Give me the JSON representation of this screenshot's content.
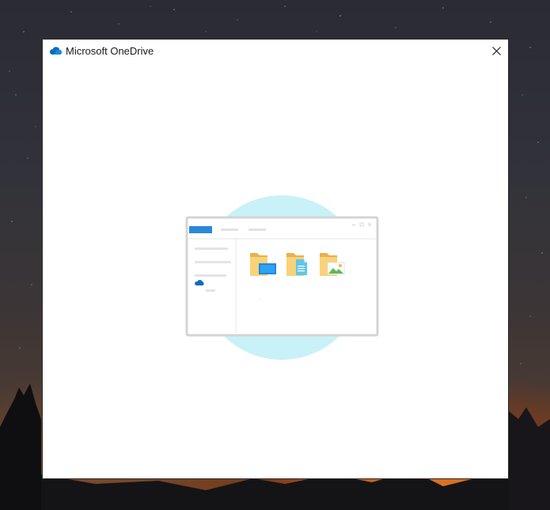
{
  "window": {
    "title": "Microsoft OneDrive",
    "app_icon": "onedrive-cloud-icon",
    "close_icon": "close-icon"
  },
  "illustration": {
    "description_icon": "file-explorer-illustration",
    "folder_icons": [
      "folder-desktop-icon",
      "folder-documents-icon",
      "folder-pictures-icon"
    ],
    "sidebar_cloud_icon": "onedrive-cloud-icon"
  },
  "colors": {
    "onedrive_blue": "#0f6cbd",
    "accent_blue": "#2b88d8",
    "circle_cyan": "#c7f0f7",
    "folder_yellow": "#f5c76a"
  }
}
